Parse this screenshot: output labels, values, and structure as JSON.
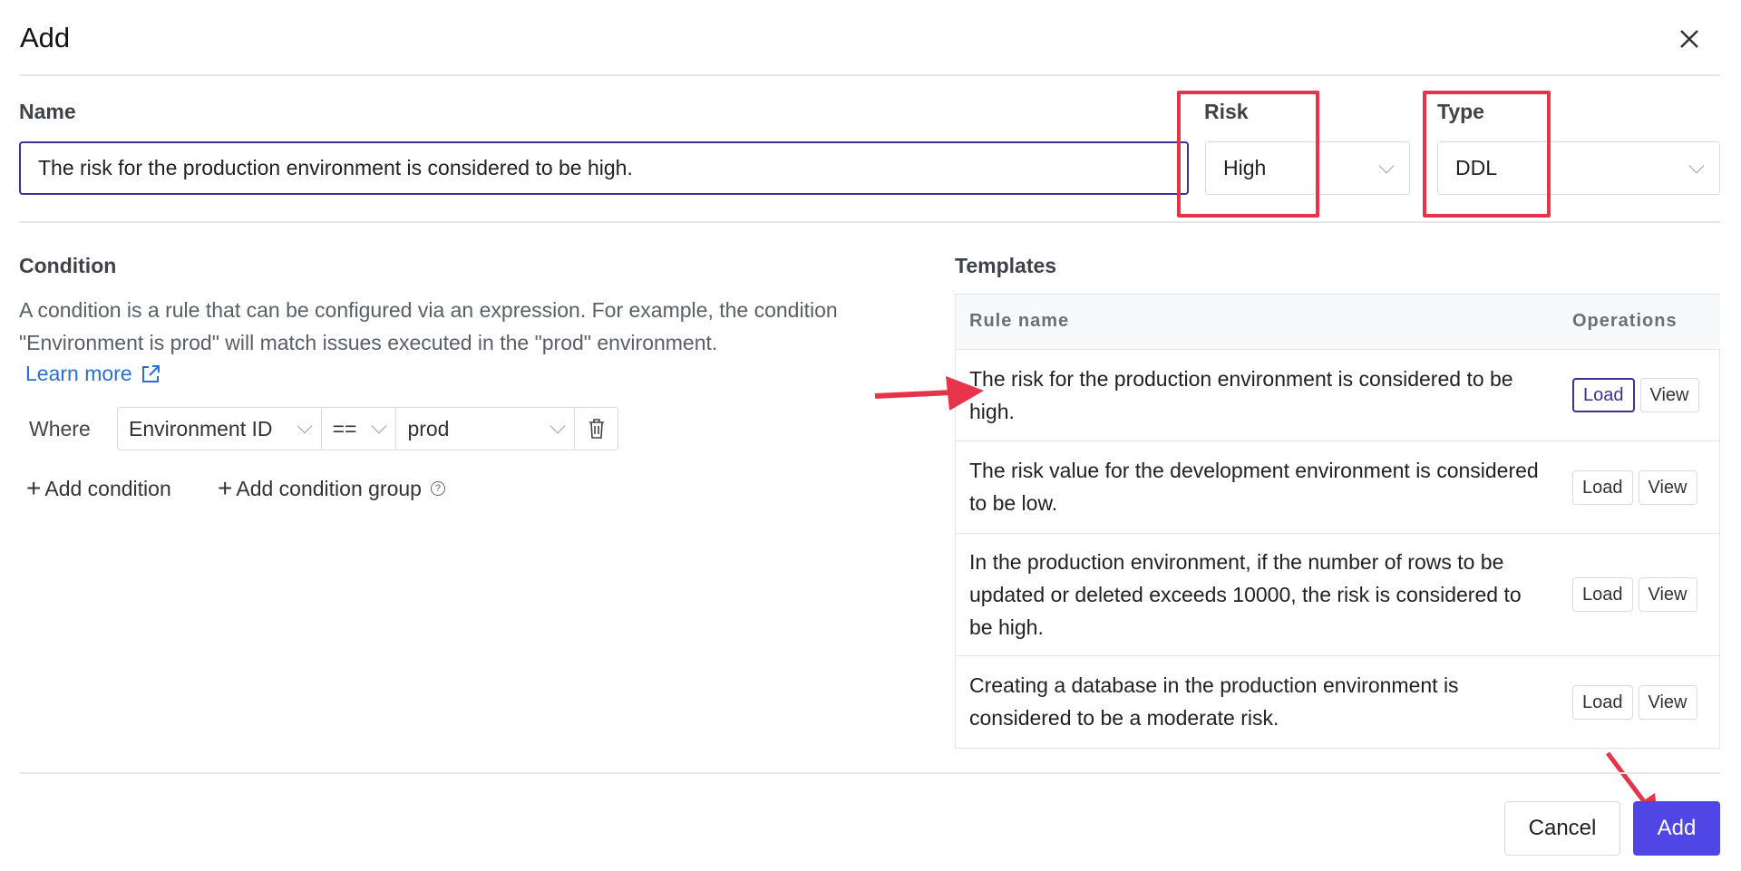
{
  "dialog": {
    "title": "Add",
    "close_icon": "close-icon"
  },
  "name": {
    "label": "Name",
    "value": "The risk for the production environment is considered to be high."
  },
  "risk": {
    "label": "Risk",
    "value": "High"
  },
  "type": {
    "label": "Type",
    "value": "DDL"
  },
  "condition": {
    "label": "Condition",
    "description": "A condition is a rule that can be configured via an expression. For example, the condition \"Environment is prod\" will match issues executed in the \"prod\" environment.",
    "learn_more": "Learn more",
    "where": "Where",
    "field": "Environment ID",
    "operator": "==",
    "value": "prod",
    "add_condition": "Add condition",
    "add_condition_group": "Add condition group"
  },
  "templates": {
    "label": "Templates",
    "columns": [
      "Rule name",
      "Operations"
    ],
    "load_label": "Load",
    "view_label": "View",
    "rows": [
      "The risk for the production environment is considered to be high.",
      "The risk value for the development environment is considered to be low.",
      "In the production environment, if the number of rows to be updated or deleted exceeds 10000, the risk is considered to be high.",
      "Creating a database in the production environment is considered to be a moderate risk."
    ]
  },
  "footer": {
    "cancel": "Cancel",
    "add": "Add"
  },
  "colors": {
    "primary": "#4f46e5",
    "active_border": "#3b3391",
    "annotation": "#e8344a",
    "link": "#2b6fd6"
  }
}
